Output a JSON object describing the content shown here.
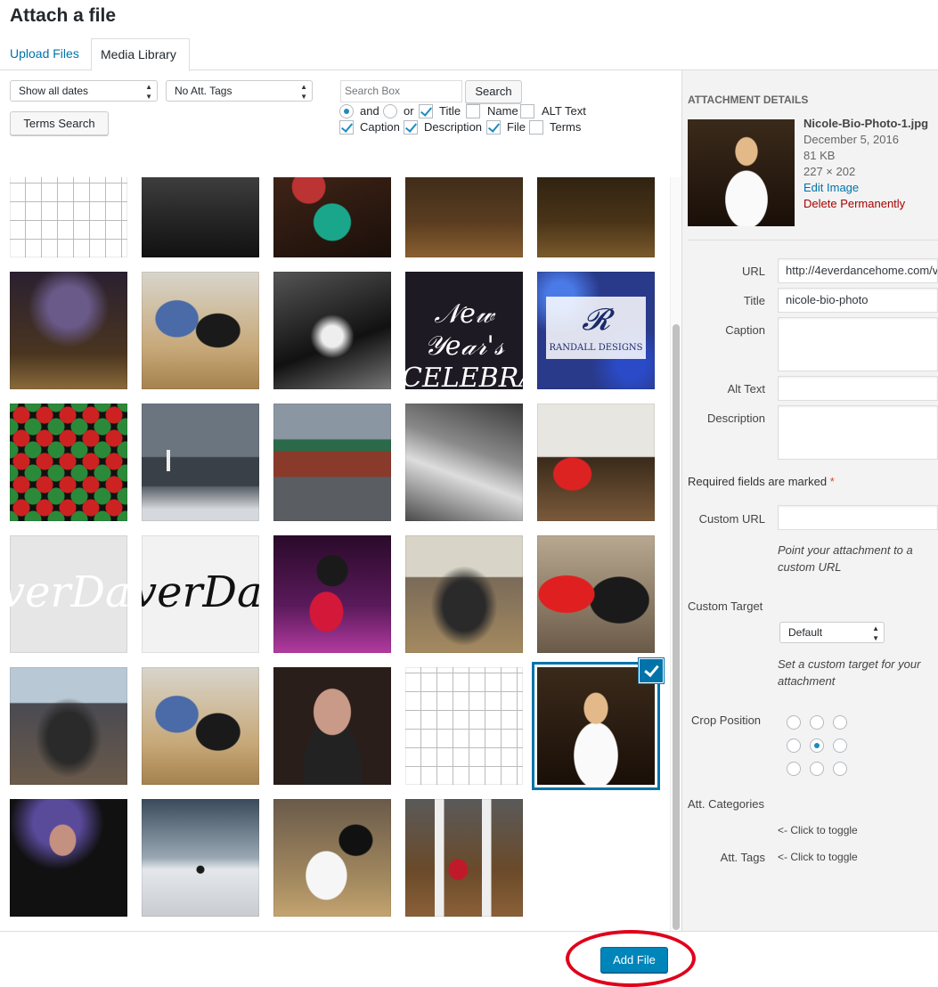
{
  "modal_title": "Attach a file",
  "tabs": {
    "upload": "Upload Files",
    "library": "Media Library"
  },
  "filters": {
    "dates": "Show all dates",
    "tags": "No Att. Tags",
    "terms_search": "Terms Search",
    "search_placeholder": "Search Box",
    "search_button": "Search",
    "and": "and",
    "or": "or",
    "title": "Title",
    "name": "Name",
    "alt_text": "ALT Text",
    "caption": "Caption",
    "description": "Description",
    "file": "File",
    "terms": "Terms"
  },
  "filter_state": {
    "and": true,
    "or": false,
    "title": true,
    "name": false,
    "alt_text": false,
    "caption": true,
    "description": true,
    "file": true,
    "terms": false
  },
  "grid": {
    "selected_index": 24,
    "items": [
      "calendar-thumb",
      "dance-floor-thumb",
      "dancers-green-dress-thumb",
      "dance-floor-dark-thumb",
      "dance-floor-dark-thumb-2",
      "dancers-silhouette-thumb",
      "dancing-couple-thumb",
      "black-white-dancers-thumb",
      "new-years-eve-celebration-thumb",
      "randall-designs-thumb",
      "ugly-sweaters-thumb",
      "parking-lot-thumb",
      "restaurant-exterior-thumb",
      "window-reflection-thumb",
      "red-dress-dancers-thumb",
      "forever-dance-logo-white-thumb",
      "forever-dance-logo-black-thumb",
      "dip-dance-thumb",
      "dance-crowd-thumb",
      "red-dress-closeup-thumb",
      "party-dancers-thumb",
      "dancing-couple-thumb-2",
      "smiling-man-thumb",
      "calendar-thumb-2",
      "nicole-bio-photo-thumb",
      "male-dancer-portrait-thumb",
      "rainbow-tree-thumb",
      "white-fringe-dancer-thumb",
      "ballroom-couple-thumb"
    ]
  },
  "details": {
    "heading": "ATTACHMENT DETAILS",
    "filename": "Nicole-Bio-Photo-1.jpg",
    "date": "December 5, 2016",
    "size": "81 KB",
    "dimensions": "227 × 202",
    "edit_image": "Edit Image",
    "delete": "Delete Permanently",
    "url_label": "URL",
    "url_value": "http://4everdancehome.com/v",
    "title_label": "Title",
    "title_value": "nicole-bio-photo",
    "caption_label": "Caption",
    "alt_label": "Alt Text",
    "description_label": "Description",
    "required_note": "Required fields are marked",
    "required_star": "*",
    "custom_url_label": "Custom URL",
    "custom_url_help": "Point your attachment to a custom URL",
    "custom_target_label": "Custom Target",
    "custom_target_value": "Default",
    "custom_target_help": "Set a custom target for your attachment",
    "crop_label": "Crop Position",
    "crop_selected": 4,
    "categories_label": "Att. Categories",
    "categories_toggle": "<- Click to toggle",
    "tags_label": "Att. Tags",
    "tags_toggle": "<- Click to toggle"
  },
  "footer": {
    "add_file": "Add File"
  },
  "colors": {
    "accent": "#0073aa",
    "primary_button": "#0085ba",
    "delete": "#a00",
    "annotation": "#e0001b"
  }
}
